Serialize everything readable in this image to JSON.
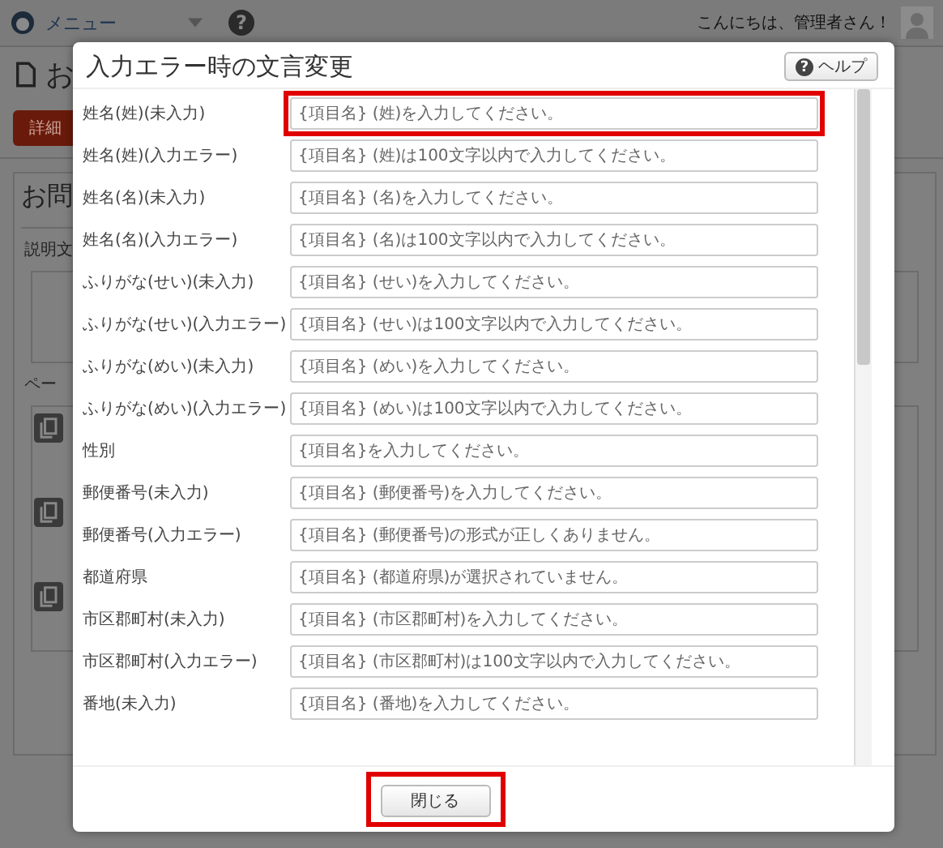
{
  "topbar": {
    "menu_label": "メニュー",
    "help_icon": "?",
    "greeting": "こんにちは、管理者さん！"
  },
  "page": {
    "title": "お",
    "detail_button": "詳細",
    "panel_title": "お問",
    "description_label": "説明文",
    "page_label": "ペー"
  },
  "dialog": {
    "title": "入力エラー時の文言変更",
    "help_icon": "?",
    "help_button": "ヘルプ",
    "rows": [
      {
        "label": "姓名(姓)(未入力)",
        "value": "{項目名} (姓)を入力してください。",
        "highlighted": true
      },
      {
        "label": "姓名(姓)(入力エラー)",
        "value": "{項目名} (姓)は100文字以内で入力してください。",
        "highlighted": false
      },
      {
        "label": "姓名(名)(未入力)",
        "value": "{項目名} (名)を入力してください。",
        "highlighted": false
      },
      {
        "label": "姓名(名)(入力エラー)",
        "value": "{項目名} (名)は100文字以内で入力してください。",
        "highlighted": false
      },
      {
        "label": "ふりがな(せい)(未入力)",
        "value": "{項目名} (せい)を入力してください。",
        "highlighted": false
      },
      {
        "label": "ふりがな(せい)(入力エラー)",
        "value": "{項目名} (せい)は100文字以内で入力してください。",
        "highlighted": false
      },
      {
        "label": "ふりがな(めい)(未入力)",
        "value": "{項目名} (めい)を入力してください。",
        "highlighted": false
      },
      {
        "label": "ふりがな(めい)(入力エラー)",
        "value": "{項目名} (めい)は100文字以内で入力してください。",
        "highlighted": false
      },
      {
        "label": "性別",
        "value": "{項目名}を入力してください。",
        "highlighted": false
      },
      {
        "label": "郵便番号(未入力)",
        "value": "{項目名} (郵便番号)を入力してください。",
        "highlighted": false
      },
      {
        "label": "郵便番号(入力エラー)",
        "value": "{項目名} (郵便番号)の形式が正しくありません。",
        "highlighted": false
      },
      {
        "label": "都道府県",
        "value": "{項目名} (都道府県)が選択されていません。",
        "highlighted": false
      },
      {
        "label": "市区郡町村(未入力)",
        "value": "{項目名} (市区郡町村)を入力してください。",
        "highlighted": false
      },
      {
        "label": "市区郡町村(入力エラー)",
        "value": "{項目名} (市区郡町村)は100文字以内で入力してください。",
        "highlighted": false
      },
      {
        "label": "番地(未入力)",
        "value": "{項目名} (番地)を入力してください。",
        "highlighted": false
      }
    ],
    "close_button": {
      "label": "閉じる",
      "highlighted": true
    }
  }
}
